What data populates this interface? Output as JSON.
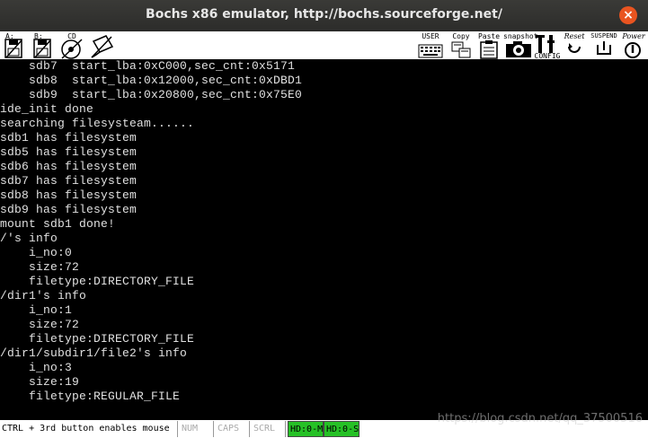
{
  "window": {
    "title": "Bochs x86 emulator, http://bochs.sourceforge.net/",
    "close_glyph": "×"
  },
  "toolbar": {
    "floppy_a": "A:",
    "floppy_b": "B:",
    "cdrom": "CD",
    "user": "USER",
    "copy": "Copy",
    "paste": "Paste",
    "snapshot": "snapshot",
    "config": "CONFIG",
    "reset": "Reset",
    "suspend": "SUSPEND",
    "power": "Power"
  },
  "console": {
    "lines": [
      "    sdb7  start_lba:0xC000,sec_cnt:0x5171",
      "    sdb8  start_lba:0x12000,sec_cnt:0xDBD1",
      "    sdb9  start_lba:0x20800,sec_cnt:0x75E0",
      "ide_init done",
      "searching filesysteam......",
      "sdb1 has filesystem",
      "sdb5 has filesystem",
      "sdb6 has filesystem",
      "sdb7 has filesystem",
      "sdb8 has filesystem",
      "sdb9 has filesystem",
      "mount sdb1 done!",
      "/'s info",
      "    i_no:0",
      "    size:72",
      "    filetype:DIRECTORY_FILE",
      "/dir1's info",
      "    i_no:1",
      "    size:72",
      "    filetype:DIRECTORY_FILE",
      "/dir1/subdir1/file2's info",
      "    i_no:3",
      "    size:19",
      "    filetype:REGULAR_FILE"
    ]
  },
  "statusbar": {
    "mouse_hint": "CTRL + 3rd button enables mouse",
    "num": "NUM",
    "caps": "CAPS",
    "scrl": "SCRL",
    "hd0_m": "HD:0-M",
    "hd0_s": "HD:0-S"
  },
  "watermark": "https://blog.csdn.net/qq_37500516",
  "colors": {
    "title_bg": "#2c2c2a",
    "close_button": "#e95420",
    "console_bg": "#000000",
    "console_fg": "#e0e0e0",
    "hd_indicator": "#26c126"
  }
}
